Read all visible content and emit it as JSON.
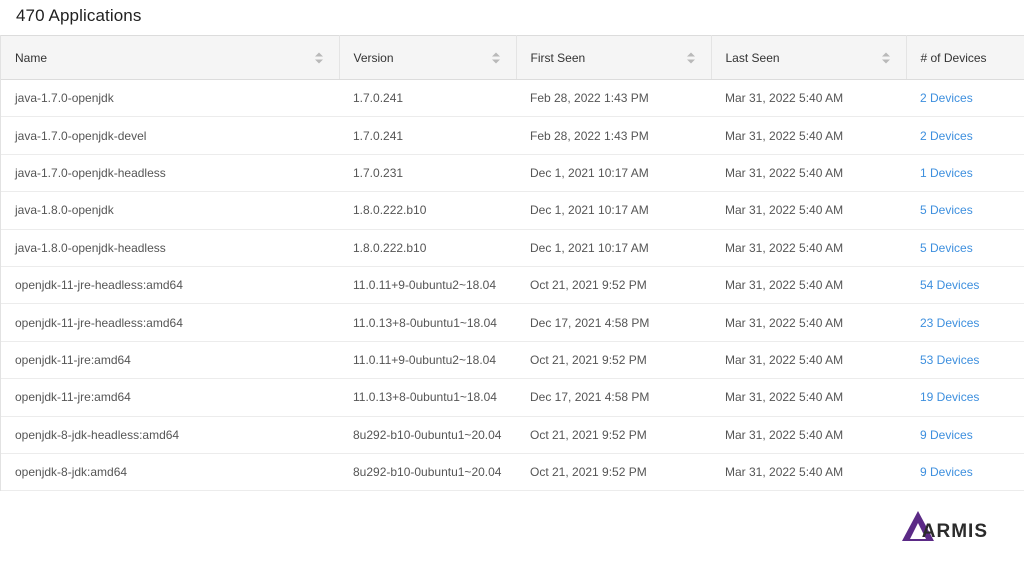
{
  "page": {
    "title": "470 Applications"
  },
  "table": {
    "columns": [
      "Name",
      "Version",
      "First Seen",
      "Last Seen",
      "# of Devices"
    ],
    "rows": [
      [
        "java-1.7.0-openjdk",
        "1.7.0.241",
        "Feb 28, 2022 1:43 PM",
        "Mar 31, 2022 5:40 AM",
        "2 Devices"
      ],
      [
        "java-1.7.0-openjdk-devel",
        "1.7.0.241",
        "Feb 28, 2022 1:43 PM",
        "Mar 31, 2022 5:40 AM",
        "2 Devices"
      ],
      [
        "java-1.7.0-openjdk-headless",
        "1.7.0.231",
        "Dec 1, 2021 10:17 AM",
        "Mar 31, 2022 5:40 AM",
        "1 Devices"
      ],
      [
        "java-1.8.0-openjdk",
        "1.8.0.222.b10",
        "Dec 1, 2021 10:17 AM",
        "Mar 31, 2022 5:40 AM",
        "5 Devices"
      ],
      [
        "java-1.8.0-openjdk-headless",
        "1.8.0.222.b10",
        "Dec 1, 2021 10:17 AM",
        "Mar 31, 2022 5:40 AM",
        "5 Devices"
      ],
      [
        "openjdk-11-jre-headless:amd64",
        "11.0.11+9-0ubuntu2~18.04",
        "Oct 21, 2021 9:52 PM",
        "Mar 31, 2022 5:40 AM",
        "54 Devices"
      ],
      [
        "openjdk-11-jre-headless:amd64",
        "11.0.13+8-0ubuntu1~18.04",
        "Dec 17, 2021 4:58 PM",
        "Mar 31, 2022 5:40 AM",
        "23 Devices"
      ],
      [
        "openjdk-11-jre:amd64",
        "11.0.11+9-0ubuntu2~18.04",
        "Oct 21, 2021 9:52 PM",
        "Mar 31, 2022 5:40 AM",
        "53 Devices"
      ],
      [
        "openjdk-11-jre:amd64",
        "11.0.13+8-0ubuntu1~18.04",
        "Dec 17, 2021 4:58 PM",
        "Mar 31, 2022 5:40 AM",
        "19 Devices"
      ],
      [
        "openjdk-8-jdk-headless:amd64",
        "8u292-b10-0ubuntu1~20.04",
        "Oct 21, 2021 9:52 PM",
        "Mar 31, 2022 5:40 AM",
        "9 Devices"
      ],
      [
        "openjdk-8-jdk:amd64",
        "8u292-b10-0ubuntu1~20.04",
        "Oct 21, 2021 9:52 PM",
        "Mar 31, 2022 5:40 AM",
        "9 Devices"
      ]
    ]
  },
  "brand": {
    "logo_text": "ARMIS",
    "logo_color": "#5b2a86",
    "link_color": "#3d8fde"
  },
  "icons": {
    "sort": "sort-icon"
  }
}
